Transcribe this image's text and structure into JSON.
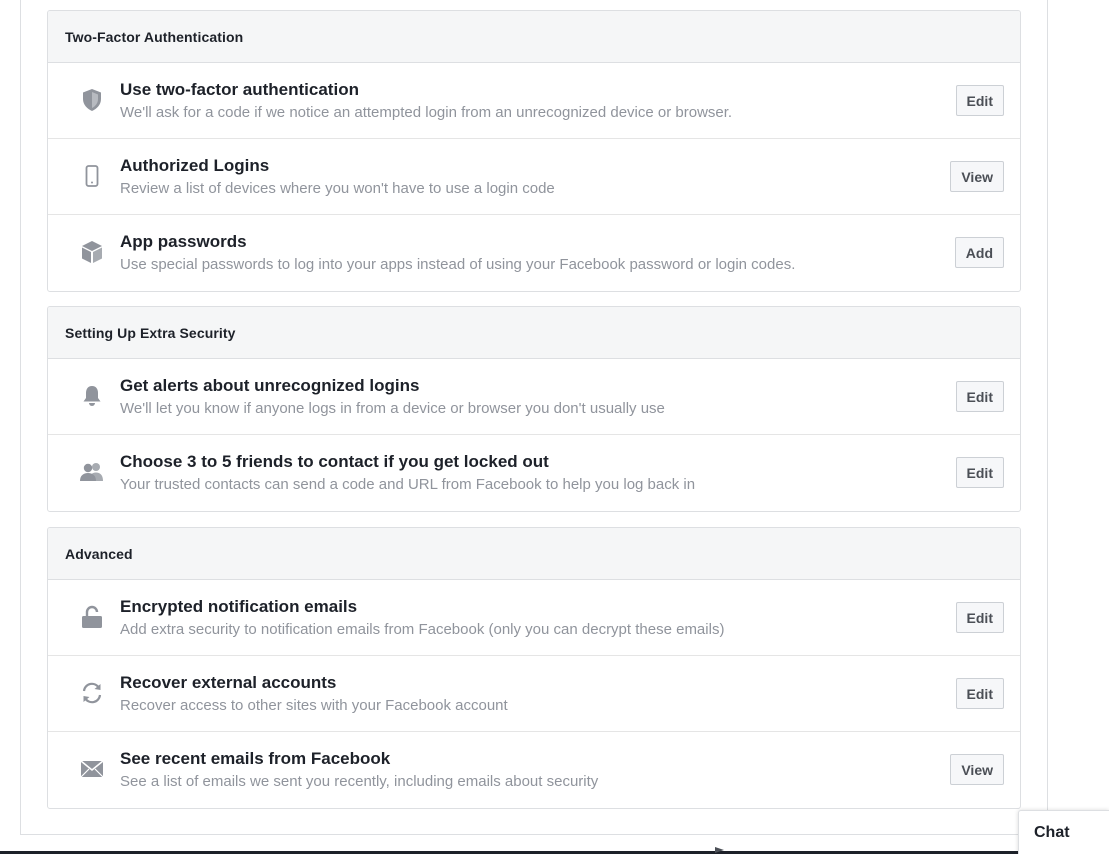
{
  "sections": [
    {
      "header": "Two-Factor Authentication",
      "rows": [
        {
          "icon": "shield-icon",
          "title": "Use two-factor authentication",
          "desc": "We'll ask for a code if we notice an attempted login from an unrecognized device or browser.",
          "button": "Edit"
        },
        {
          "icon": "phone-icon",
          "title": "Authorized Logins",
          "desc": "Review a list of devices where you won't have to use a login code",
          "button": "View"
        },
        {
          "icon": "cube-icon",
          "title": "App passwords",
          "desc": "Use special passwords to log into your apps instead of using your Facebook password or login codes.",
          "button": "Add"
        }
      ]
    },
    {
      "header": "Setting Up Extra Security",
      "rows": [
        {
          "icon": "bell-icon",
          "title": "Get alerts about unrecognized logins",
          "desc": "We'll let you know if anyone logs in from a device or browser you don't usually use",
          "button": "Edit"
        },
        {
          "icon": "friends-icon",
          "title": "Choose 3 to 5 friends to contact if you get locked out",
          "desc": "Your trusted contacts can send a code and URL from Facebook to help you log back in",
          "button": "Edit"
        }
      ]
    },
    {
      "header": "Advanced",
      "rows": [
        {
          "icon": "lock-icon",
          "title": "Encrypted notification emails",
          "desc": "Add extra security to notification emails from Facebook (only you can decrypt these emails)",
          "button": "Edit"
        },
        {
          "icon": "refresh-icon",
          "title": "Recover external accounts",
          "desc": "Recover access to other sites with your Facebook account",
          "button": "Edit"
        },
        {
          "icon": "envelope-icon",
          "title": "See recent emails from Facebook",
          "desc": "See a list of emails we sent you recently, including emails about security",
          "button": "View"
        }
      ]
    }
  ],
  "chat": {
    "label": "Chat"
  },
  "colors": {
    "icon": "#90949c",
    "title": "#1d2129",
    "desc": "#90949c",
    "header_bg": "#f5f6f7",
    "border": "#dddfe2"
  }
}
